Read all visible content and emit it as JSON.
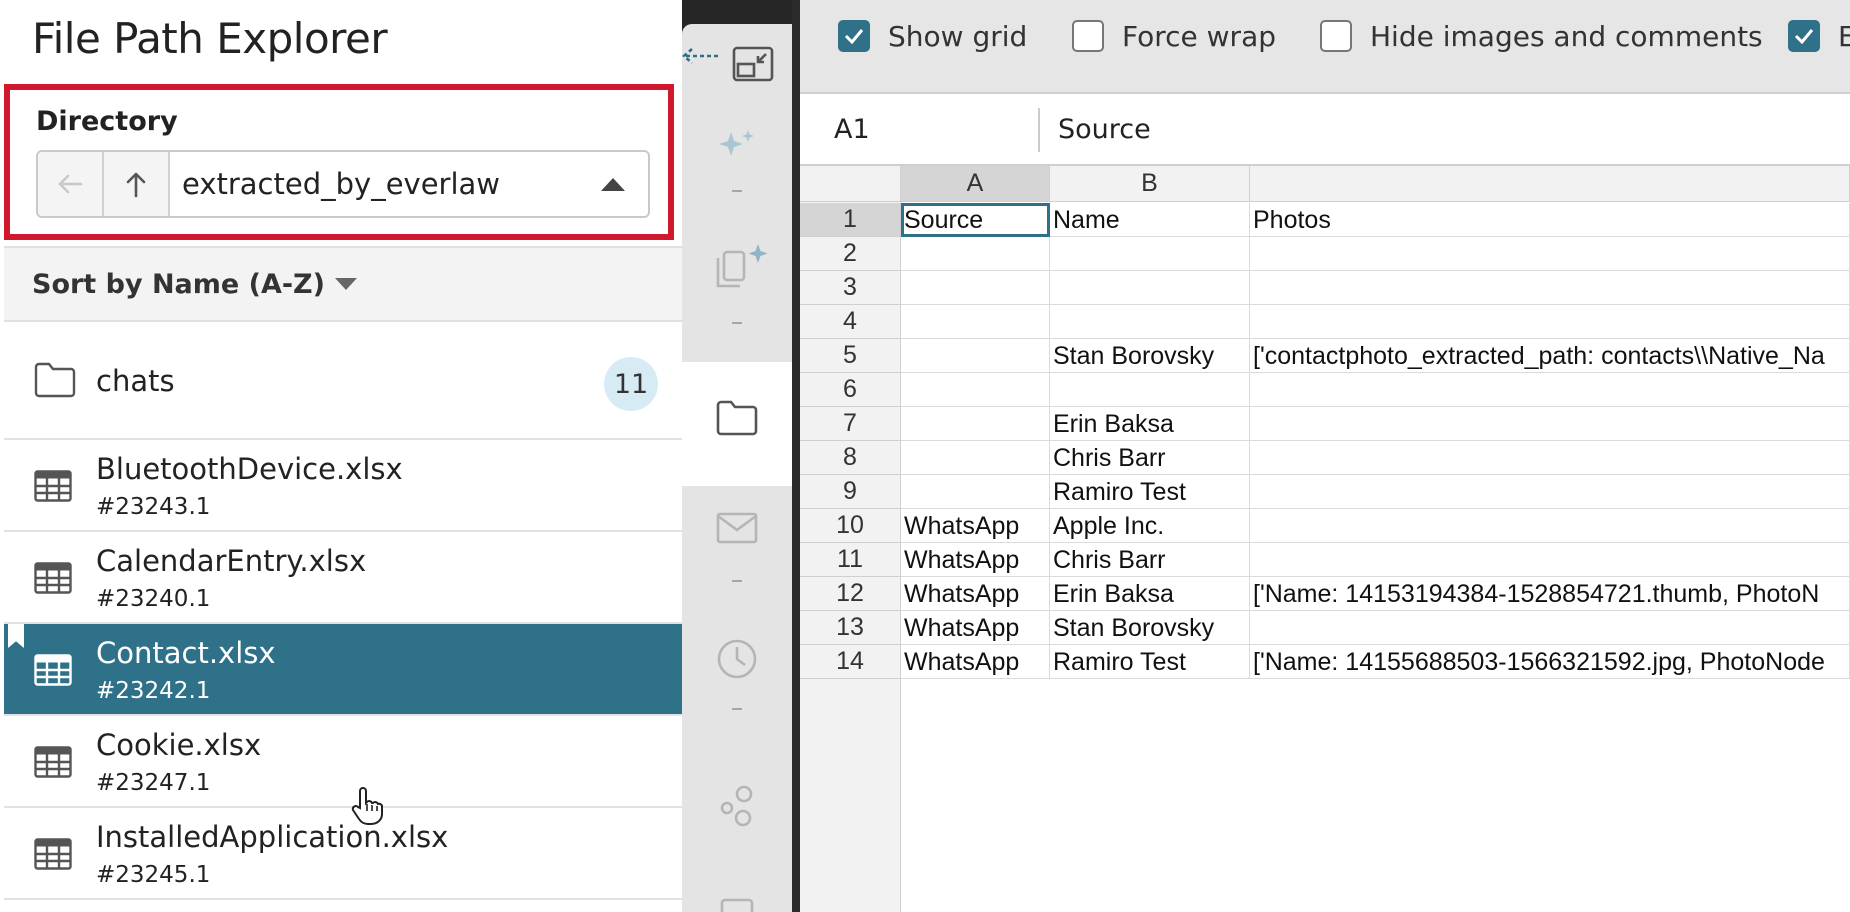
{
  "explorer": {
    "title": "File Path Explorer",
    "directory_label": "Directory",
    "directory_value": "extracted_by_everlaw",
    "sort_label": "Sort by Name (A-Z)",
    "items": [
      {
        "type": "folder",
        "name": "chats",
        "badge": "11"
      },
      {
        "type": "file",
        "name": "BluetoothDevice.xlsx",
        "id": "#23243.1"
      },
      {
        "type": "file",
        "name": "CalendarEntry.xlsx",
        "id": "#23240.1"
      },
      {
        "type": "file",
        "name": "Contact.xlsx",
        "id": "#23242.1",
        "selected": true
      },
      {
        "type": "file",
        "name": "Cookie.xlsx",
        "id": "#23247.1"
      },
      {
        "type": "file",
        "name": "InstalledApplication.xlsx",
        "id": "#23245.1"
      }
    ]
  },
  "strip": {
    "icons": [
      "collapse-arrow-icon",
      "sparkle-icon",
      "copy-sparkle-icon",
      "folder-icon",
      "mail-icon",
      "clock-icon",
      "bubbles-icon"
    ]
  },
  "options": {
    "show_grid": {
      "label": "Show grid",
      "checked": true
    },
    "force_wrap": {
      "label": "Force wrap",
      "checked": false
    },
    "hide_images": {
      "label": "Hide images and comments",
      "checked": false
    },
    "extra": {
      "label": "E",
      "checked": true
    }
  },
  "formula": {
    "cell_ref": "A1",
    "value": "Source"
  },
  "sheet": {
    "columns": [
      "A",
      "B",
      ""
    ],
    "rows": [
      {
        "n": "1",
        "cells": [
          "Source",
          "Name",
          "Photos"
        ]
      },
      {
        "n": "2",
        "cells": [
          "",
          "",
          ""
        ]
      },
      {
        "n": "3",
        "cells": [
          "",
          "",
          ""
        ]
      },
      {
        "n": "4",
        "cells": [
          "",
          "",
          ""
        ]
      },
      {
        "n": "5",
        "cells": [
          "",
          "Stan Borovsky",
          "['contactphoto_extracted_path: contacts\\\\Native_Na"
        ]
      },
      {
        "n": "6",
        "cells": [
          "",
          "",
          ""
        ]
      },
      {
        "n": "7",
        "cells": [
          "",
          "Erin Baksa",
          ""
        ]
      },
      {
        "n": "8",
        "cells": [
          "",
          "Chris Barr",
          ""
        ]
      },
      {
        "n": "9",
        "cells": [
          "",
          "Ramiro Test",
          ""
        ]
      },
      {
        "n": "10",
        "cells": [
          "WhatsApp",
          "Apple Inc.",
          ""
        ]
      },
      {
        "n": "11",
        "cells": [
          "WhatsApp",
          "Chris Barr",
          ""
        ]
      },
      {
        "n": "12",
        "cells": [
          "WhatsApp",
          "Erin Baksa",
          "['Name: 14153194384-1528854721.thumb, PhotoN"
        ]
      },
      {
        "n": "13",
        "cells": [
          "WhatsApp",
          "Stan Borovsky",
          ""
        ]
      },
      {
        "n": "14",
        "cells": [
          "WhatsApp",
          "Ramiro Test",
          "['Name: 14155688503-1566321592.jpg, PhotoNode"
        ]
      }
    ]
  },
  "colors": {
    "accent": "#2e7189",
    "highlight_border": "#d0192e"
  }
}
